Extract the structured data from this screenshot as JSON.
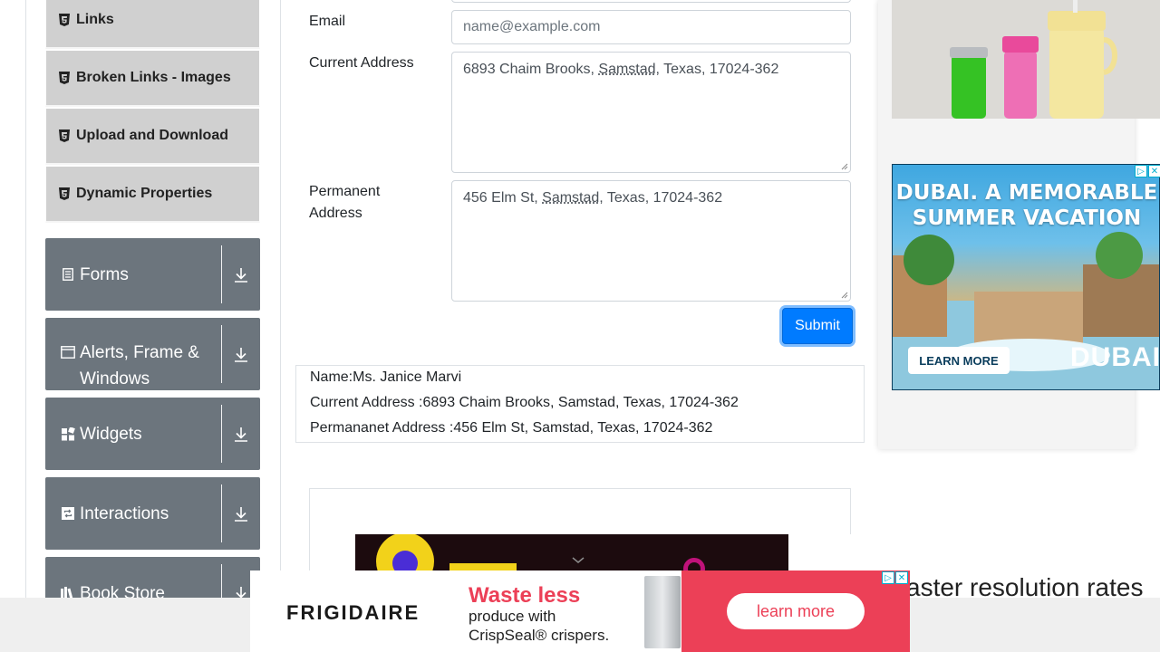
{
  "sidebar": {
    "sub_items": [
      {
        "label": "Links",
        "icon": "html5-icon"
      },
      {
        "label": "Broken Links - Images",
        "icon": "html5-icon"
      },
      {
        "label": "Upload and Download",
        "icon": "html5-icon"
      },
      {
        "label": "Dynamic Properties",
        "icon": "html5-icon"
      }
    ],
    "groups": [
      {
        "label": "Forms",
        "icon": "form-icon"
      },
      {
        "label": "Alerts, Frame & Windows",
        "icon": "window-icon"
      },
      {
        "label": "Widgets",
        "icon": "widgets-icon"
      },
      {
        "label": "Interactions",
        "icon": "interactions-icon"
      },
      {
        "label": "Book Store",
        "icon": "books-icon"
      }
    ]
  },
  "form": {
    "email": {
      "label": "Email",
      "placeholder": "name@example.com",
      "value": ""
    },
    "current_address": {
      "label": "Current Address",
      "value_parts": [
        "6893 Chaim Brooks, ",
        "Samstad",
        ", Texas, 17024-362"
      ]
    },
    "permanent_address": {
      "label_line1": "Permanent",
      "label_line2": "Address",
      "value_parts": [
        "456 Elm St, ",
        "Samstad",
        ", Texas, 17024-362"
      ]
    },
    "submit_label": "Submit"
  },
  "output": {
    "name": "Name:Ms. Janice Marvi",
    "current_address": "Current Address :6893 Chaim Brooks, Samstad, Texas, 17024-362",
    "permanent_address": "Permananet Address :456 Elm St, Samstad, Texas, 17024-362"
  },
  "ads": {
    "dubai": {
      "headline1": "DUBAI. A MEMORABLE",
      "headline2": "SUMMER VACATION",
      "cta": "LEARN MORE",
      "brand": "DUBAI"
    },
    "mid_banner_text": "aster resolution rates",
    "bottom": {
      "brand": "FRIGIDAIRE",
      "headline": "Waste less",
      "sub_line1": "produce with",
      "sub_line2": "CrispSeal® crispers.",
      "cta": "learn more"
    }
  },
  "colors": {
    "submit": "#007bff",
    "group_bg": "#6c757d",
    "sub_item_bg": "#d0d0d0",
    "ad_pink": "#ec4057"
  }
}
